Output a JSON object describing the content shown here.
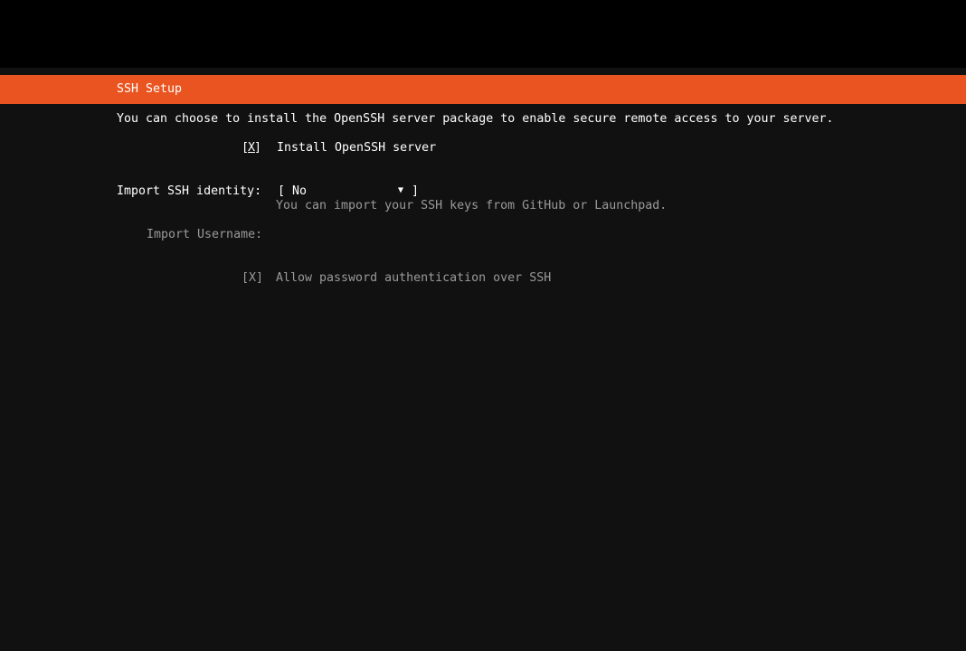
{
  "header": {
    "title": "SSH Setup"
  },
  "intro": "You can choose to install the OpenSSH server package to enable secure remote access to your server.",
  "install_openssh": {
    "box_open": "[",
    "box_mark": "X",
    "box_close": "]",
    "label": "Install OpenSSH server",
    "checked": true
  },
  "import_identity": {
    "label": "Import SSH identity:",
    "select_open": "[ No",
    "arrow": "▼",
    "select_close": "]",
    "selected": "No",
    "help": "You can import your SSH keys from GitHub or Launchpad."
  },
  "import_username": {
    "label": "Import Username:",
    "value": ""
  },
  "password_auth": {
    "box": "[X]",
    "label": "Allow password authentication over SSH",
    "checked": true
  },
  "colors": {
    "accent": "#e95420",
    "background": "#111111",
    "text": "#ffffff",
    "dim_text": "#9a9a9a"
  }
}
